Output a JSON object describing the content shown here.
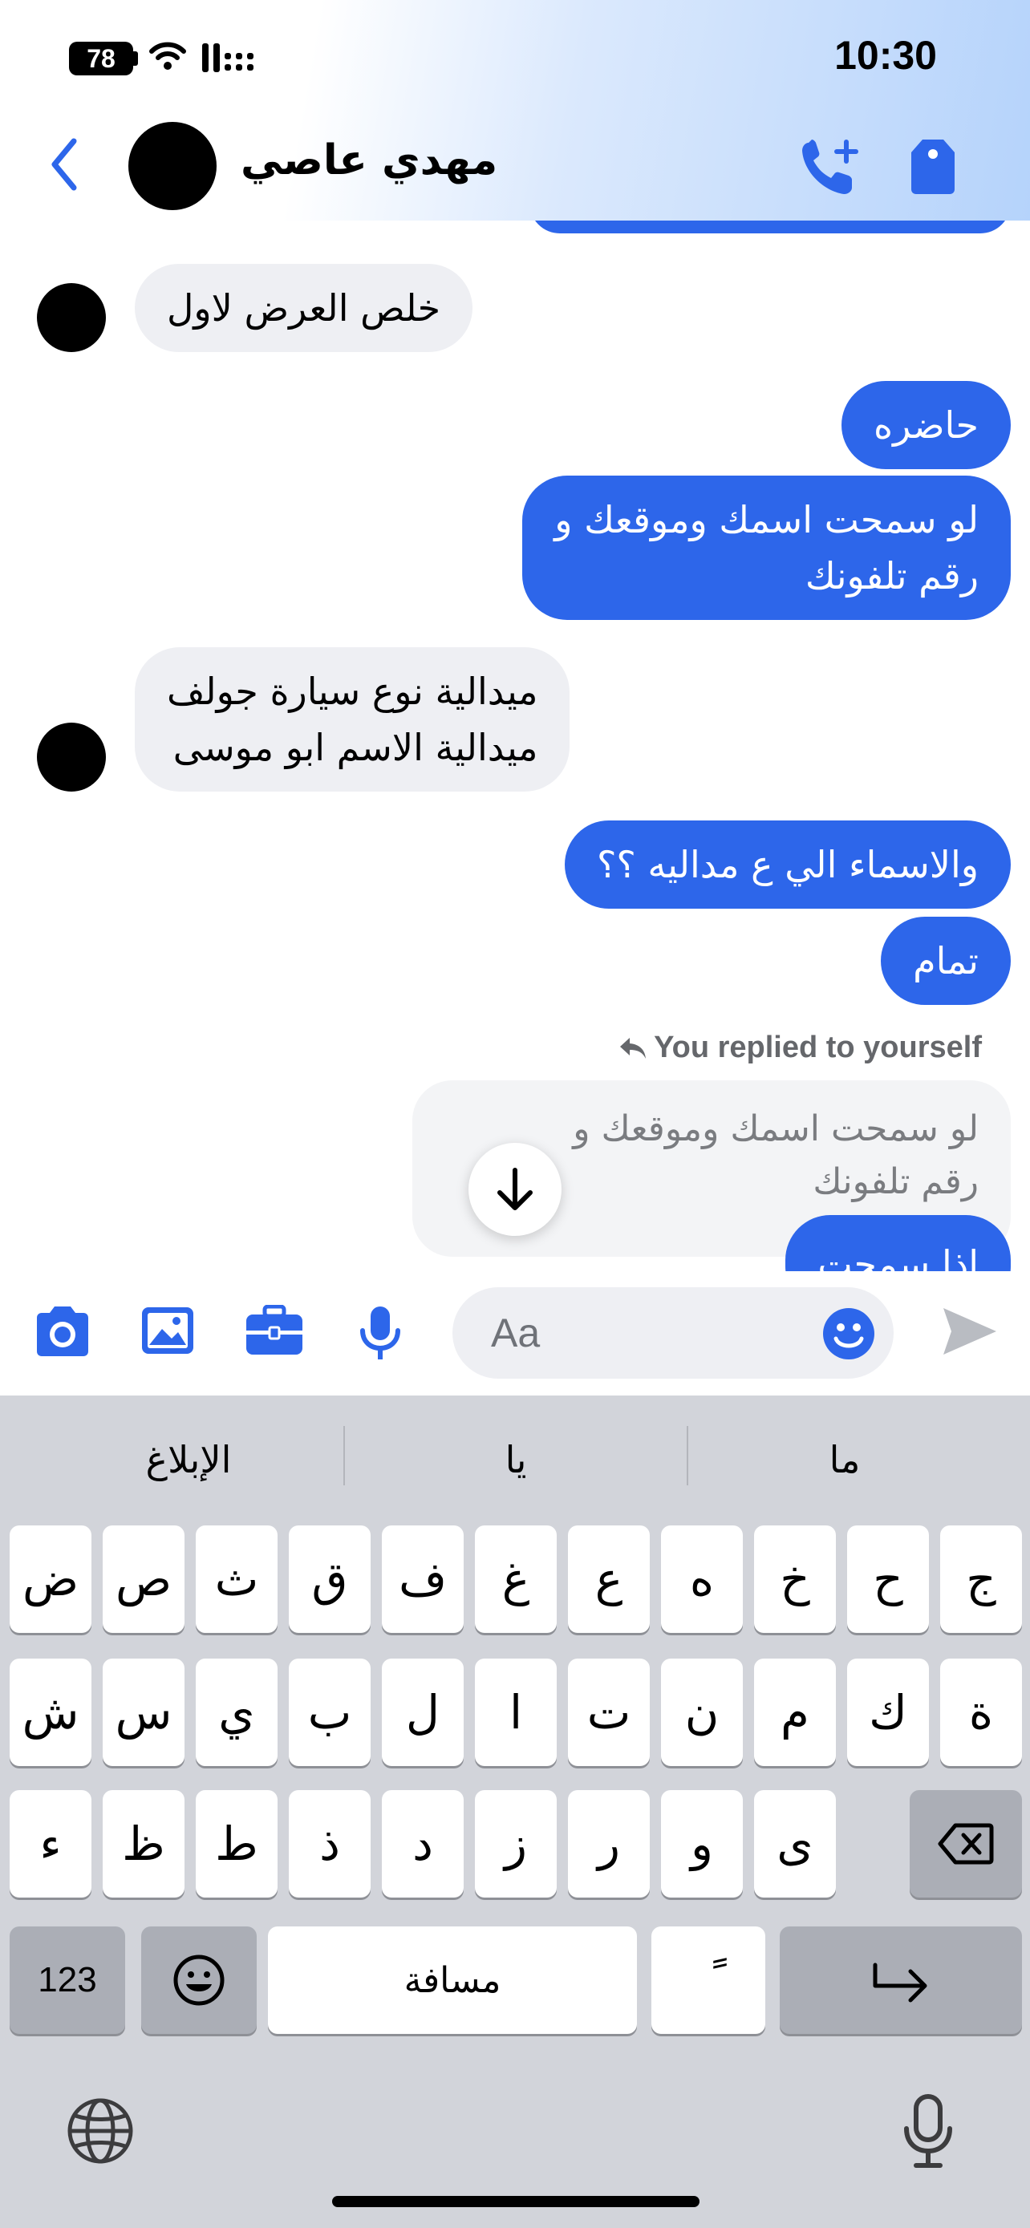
{
  "status": {
    "battery": "78",
    "time": "10:30"
  },
  "header": {
    "contact_name": "مهدي عاصي"
  },
  "messages": [
    {
      "from": "in",
      "text": "خلص العرض لاول"
    },
    {
      "from": "out",
      "text": "حاضره"
    },
    {
      "from": "out",
      "line1": "لو سمحت اسمك وموقعك و",
      "line2": "رقم تلفونك"
    },
    {
      "from": "in",
      "line1": "ميدالية نوع سيارة جولف",
      "line2": "ميدالية الاسم ابو موسى"
    },
    {
      "from": "out",
      "text": "والاسماء الي ع مداليه ؟؟"
    },
    {
      "from": "out",
      "text": "تمام"
    }
  ],
  "reply": {
    "note": "You replied to yourself",
    "quoted_line1": "لو سمحت اسمك وموقعك و",
    "quoted_line2": "رقم تلفونك",
    "partial_message": "اذا سمحت"
  },
  "composer": {
    "placeholder": "Aa"
  },
  "keyboard": {
    "suggestions": [
      "الإبلاغ",
      "يا",
      "ما"
    ],
    "row1": [
      "ض",
      "ص",
      "ث",
      "ق",
      "ف",
      "غ",
      "ع",
      "ه",
      "خ",
      "ح",
      "ج"
    ],
    "row2": [
      "ش",
      "س",
      "ي",
      "ب",
      "ل",
      "ا",
      "ت",
      "ن",
      "م",
      "ك",
      "ة"
    ],
    "row3": [
      "ء",
      "ظ",
      "ط",
      "ذ",
      "د",
      "ز",
      "ر",
      "و",
      "ى"
    ],
    "numbers_label": "123",
    "space_label": "مسافة",
    "diacritic_label": "ً"
  },
  "colors": {
    "accent": "#2d66ea",
    "incoming_bubble": "#eeeff3",
    "keyboard_bg": "#d2d4da"
  },
  "icons": [
    "battery-icon",
    "wifi-icon",
    "signal-icon",
    "back-chevron-icon",
    "add-call-icon",
    "tag-icon",
    "reply-arrow-icon",
    "arrow-down-icon",
    "camera-icon",
    "image-icon",
    "briefcase-icon",
    "microphone-icon",
    "emoji-icon",
    "send-icon",
    "backspace-icon",
    "return-icon",
    "globe-icon",
    "dictation-mic-icon"
  ]
}
